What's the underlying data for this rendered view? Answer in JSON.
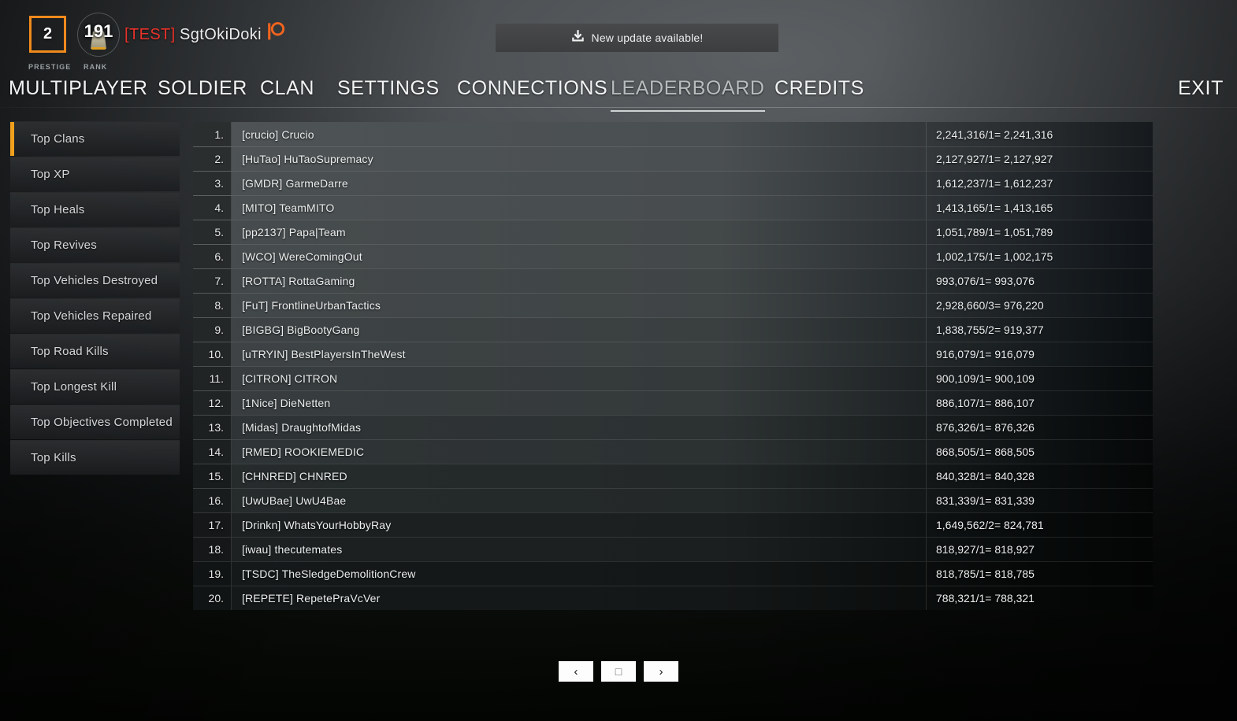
{
  "player": {
    "prestige_value": "2",
    "prestige_label": "PRESTIGE",
    "rank_value": "191",
    "rank_label": "RANK",
    "clan_tag": "[TEST]",
    "name": "SgtOkiDoki",
    "patreon_icon": "patreon-icon"
  },
  "update_banner": {
    "icon": "download-icon",
    "text": "New update available!"
  },
  "nav": {
    "items": [
      {
        "label": "MULTIPLAYER",
        "active": false
      },
      {
        "label": "SOLDIER",
        "active": false
      },
      {
        "label": "CLAN",
        "active": false
      },
      {
        "label": "SETTINGS",
        "active": false
      },
      {
        "label": "CONNECTIONS",
        "active": false
      },
      {
        "label": "LEADERBOARD",
        "active": true
      },
      {
        "label": "CREDITS",
        "active": false
      }
    ],
    "exit_label": "EXIT"
  },
  "sidebar": {
    "items": [
      {
        "label": "Top Clans",
        "active": true
      },
      {
        "label": "Top XP",
        "active": false
      },
      {
        "label": "Top Heals",
        "active": false
      },
      {
        "label": "Top Revives",
        "active": false
      },
      {
        "label": "Top Vehicles Destroyed",
        "active": false
      },
      {
        "label": "Top Vehicles Repaired",
        "active": false
      },
      {
        "label": "Top Road Kills",
        "active": false
      },
      {
        "label": "Top Longest Kill",
        "active": false
      },
      {
        "label": "Top Objectives Completed",
        "active": false
      },
      {
        "label": "Top Kills",
        "active": false
      }
    ]
  },
  "leaderboard": {
    "rows": [
      {
        "rank": "1.",
        "name": "[crucio] Crucio",
        "score": "2,241,316/1= 2,241,316"
      },
      {
        "rank": "2.",
        "name": "[HuTao] HuTaoSupremacy",
        "score": "2,127,927/1= 2,127,927"
      },
      {
        "rank": "3.",
        "name": "[GMDR] GarmeDarre",
        "score": "1,612,237/1= 1,612,237"
      },
      {
        "rank": "4.",
        "name": "[MITO] TeamMITO",
        "score": "1,413,165/1= 1,413,165"
      },
      {
        "rank": "5.",
        "name": "[pp2137] Papa|Team",
        "score": "1,051,789/1= 1,051,789"
      },
      {
        "rank": "6.",
        "name": "[WCO] WereComingOut",
        "score": "1,002,175/1= 1,002,175"
      },
      {
        "rank": "7.",
        "name": "[ROTTA] RottaGaming",
        "score": "993,076/1= 993,076"
      },
      {
        "rank": "8.",
        "name": "[FuT] FrontlineUrbanTactics",
        "score": "2,928,660/3= 976,220"
      },
      {
        "rank": "9.",
        "name": "[BIGBG] BigBootyGang",
        "score": "1,838,755/2= 919,377"
      },
      {
        "rank": "10.",
        "name": "[uTRYIN] BestPlayersInTheWest",
        "score": "916,079/1= 916,079"
      },
      {
        "rank": "11.",
        "name": "[CITRON] CITRON",
        "score": "900,109/1= 900,109"
      },
      {
        "rank": "12.",
        "name": "[1Nice] DieNetten",
        "score": "886,107/1= 886,107"
      },
      {
        "rank": "13.",
        "name": "[Midas] DraughtofMidas",
        "score": "876,326/1= 876,326"
      },
      {
        "rank": "14.",
        "name": "[RMED] ROOKIEMEDIC",
        "score": "868,505/1= 868,505"
      },
      {
        "rank": "15.",
        "name": "[CHNRED] CHNRED",
        "score": "840,328/1= 840,328"
      },
      {
        "rank": "16.",
        "name": "[UwUBae] UwU4Bae",
        "score": "831,339/1= 831,339"
      },
      {
        "rank": "17.",
        "name": "[Drinkn] WhatsYourHobbyRay",
        "score": "1,649,562/2= 824,781"
      },
      {
        "rank": "18.",
        "name": "[iwau] thecutemates",
        "score": "818,927/1= 818,927"
      },
      {
        "rank": "19.",
        "name": "[TSDC] TheSledgeDemolitionCrew",
        "score": "818,785/1= 818,785"
      },
      {
        "rank": "20.",
        "name": "[REPETE] RepetePraVcVer",
        "score": "788,321/1= 788,321"
      }
    ]
  },
  "pagination": {
    "prev_label": "‹",
    "page_label": "□",
    "next_label": "›"
  },
  "colors": {
    "accent_orange": "#f0a01c",
    "prestige_border": "#f08a1c",
    "clan_tag_red": "#e8332a",
    "text_primary": "#eceeee"
  }
}
